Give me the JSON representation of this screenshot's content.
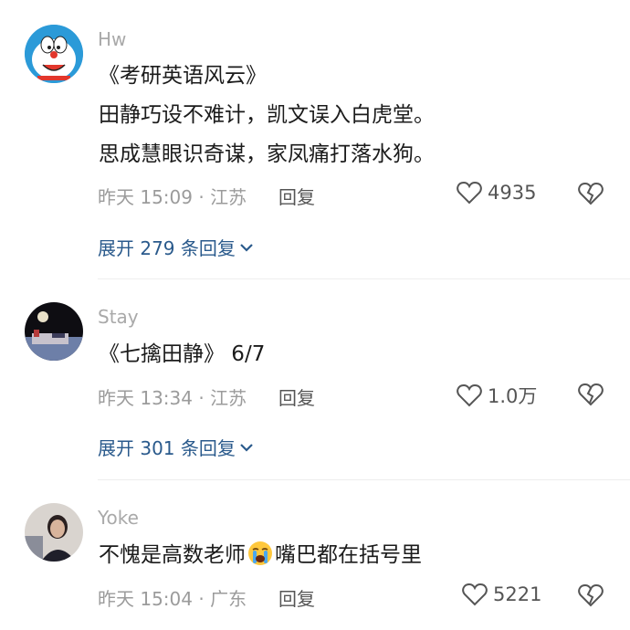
{
  "comments": [
    {
      "username": "Hw",
      "lines": [
        "《考研英语风云》",
        " 田静巧设不难计，凯文误入白虎堂。",
        " 思成慧眼识奇谋，家凤痛打落水狗。"
      ],
      "meta": "昨天 15:09 · 江苏",
      "reply_label": "回复",
      "likes": "4935",
      "expand_label": "展开 279 条回复",
      "avatar": "doraemon-avatar"
    },
    {
      "username": "Stay",
      "lines": [
        "《七擒田静》 6/7"
      ],
      "meta": "昨天 13:34 · 江苏",
      "reply_label": "回复",
      "likes": "1.0万",
      "expand_label": "展开 301 条回复",
      "avatar": "night-scene-avatar"
    },
    {
      "username": "Yoke",
      "text_before": "不愧是高数老师",
      "emoji": "crying-face-emoji",
      "text_after": "嘴巴都在括号里",
      "meta": "昨天 15:04 · 广东",
      "reply_label": "回复",
      "likes": "5221",
      "avatar": "person-photo-avatar"
    }
  ],
  "colors": {
    "link": "#2a5a8c",
    "meta": "#9b9b9b",
    "text": "#1b1b1b"
  }
}
